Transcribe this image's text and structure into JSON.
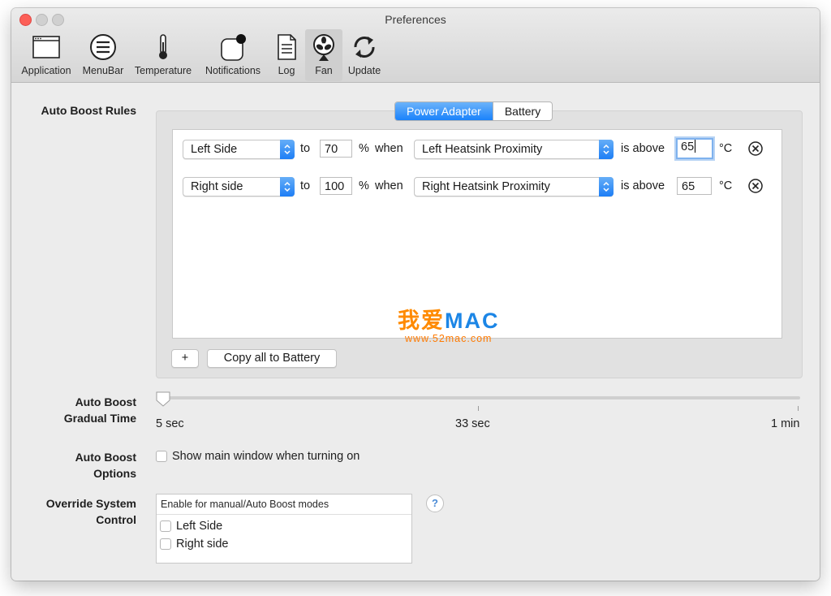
{
  "window": {
    "title": "Preferences"
  },
  "toolbar": {
    "items": [
      {
        "label": "Application",
        "icon": "application-window-icon"
      },
      {
        "label": "MenuBar",
        "icon": "menubar-list-icon"
      },
      {
        "label": "Temperature",
        "icon": "thermometer-icon"
      },
      {
        "label": "Notifications",
        "icon": "notification-badge-icon"
      },
      {
        "label": "Log",
        "icon": "log-document-icon"
      },
      {
        "label": "Fan",
        "icon": "fan-icon"
      },
      {
        "label": "Update",
        "icon": "sync-arrows-icon"
      }
    ],
    "selected": "Fan"
  },
  "auto_boost_rules": {
    "label": "Auto Boost  Rules",
    "tabs": [
      "Power Adapter",
      "Battery"
    ],
    "selected_tab": "Power Adapter",
    "rules": [
      {
        "side": "Left Side",
        "to_text": "to",
        "percent": "70",
        "percent_text": "%",
        "when_text": "when",
        "sensor": "Left Heatsink Proximity",
        "above_text": "is above",
        "threshold": "65",
        "unit": "°C"
      },
      {
        "side": "Right side",
        "to_text": "to",
        "percent": "100",
        "percent_text": "%",
        "when_text": "when",
        "sensor": "Right Heatsink Proximity",
        "above_text": "is above",
        "threshold": "65",
        "unit": "°C"
      }
    ],
    "add_label": "+",
    "copy_label": "Copy all to Battery"
  },
  "watermark": {
    "cn": "我爱",
    "en": "MAC",
    "url": "www.52mac.com"
  },
  "gradual_time": {
    "label_line1": "Auto Boost",
    "label_line2": "Gradual Time",
    "min_label": "5 sec",
    "mid_label": "33 sec",
    "max_label": "1 min",
    "value_fraction": 0.0
  },
  "options": {
    "label_line1": "Auto Boost",
    "label_line2": "Options",
    "checkbox_label": "Show main window when turning on",
    "checked": false
  },
  "override": {
    "label_line1": "Override System",
    "label_line2": "Control",
    "header": "Enable for manual/Auto Boost modes",
    "items": [
      {
        "label": "Left Side",
        "checked": false
      },
      {
        "label": "Right side",
        "checked": false
      }
    ],
    "help_label": "?"
  },
  "colors": {
    "accent": "#1a82fb",
    "close": "#fc5f57",
    "watermark_orange": "#ff8a00",
    "watermark_blue": "#1c86e6"
  }
}
